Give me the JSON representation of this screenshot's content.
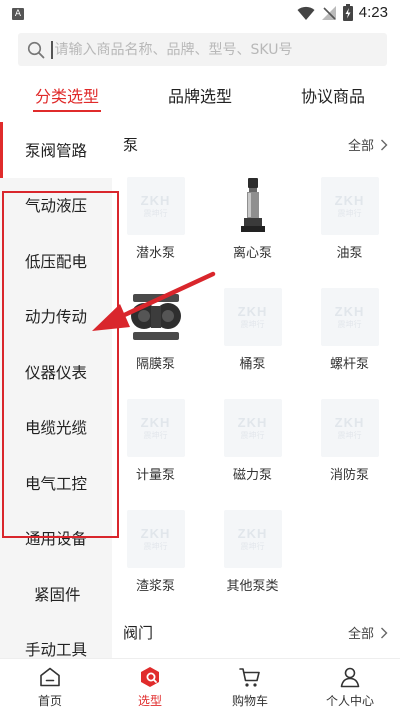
{
  "status_bar": {
    "time": "4:23",
    "app_badge": "A"
  },
  "search": {
    "placeholder": "请输入商品名称、品牌、型号、SKU号"
  },
  "top_tabs": [
    {
      "label": "分类选型",
      "active": true
    },
    {
      "label": "品牌选型",
      "active": false
    },
    {
      "label": "协议商品",
      "active": false
    }
  ],
  "sidebar": {
    "items": [
      {
        "label": "泵阀管路",
        "active": true
      },
      {
        "label": "气动液压"
      },
      {
        "label": "低压配电"
      },
      {
        "label": "动力传动"
      },
      {
        "label": "仪器仪表"
      },
      {
        "label": "电缆光缆"
      },
      {
        "label": "电气工控"
      },
      {
        "label": "通用设备"
      },
      {
        "label": "紧固件"
      },
      {
        "label": "手动工具"
      }
    ]
  },
  "sections": [
    {
      "title": "泵",
      "all_label": "全部",
      "products": [
        {
          "label": "潜水泵",
          "image": "placeholder"
        },
        {
          "label": "离心泵",
          "image": "centrifugal-pump"
        },
        {
          "label": "油泵",
          "image": "placeholder"
        },
        {
          "label": "隔膜泵",
          "image": "diaphragm-pump"
        },
        {
          "label": "桶泵",
          "image": "placeholder"
        },
        {
          "label": "螺杆泵",
          "image": "placeholder"
        },
        {
          "label": "计量泵",
          "image": "placeholder"
        },
        {
          "label": "磁力泵",
          "image": "placeholder"
        },
        {
          "label": "消防泵",
          "image": "placeholder"
        },
        {
          "label": "渣浆泵",
          "image": "placeholder"
        },
        {
          "label": "其他泵类",
          "image": "placeholder"
        }
      ]
    },
    {
      "title": "阀门",
      "all_label": "全部"
    }
  ],
  "placeholder_watermark": {
    "logo": "ZKH",
    "sub": "震坤行"
  },
  "bottom_nav": [
    {
      "label": "首页",
      "icon": "home-icon",
      "active": false
    },
    {
      "label": "选型",
      "icon": "selection-icon",
      "active": true
    },
    {
      "label": "购物车",
      "icon": "cart-icon",
      "active": false
    },
    {
      "label": "个人中心",
      "icon": "user-icon",
      "active": false
    }
  ],
  "colors": {
    "accent": "#e02b2b",
    "annotation_red": "#d9262c",
    "sidebar_bg": "#f5f5f5"
  }
}
